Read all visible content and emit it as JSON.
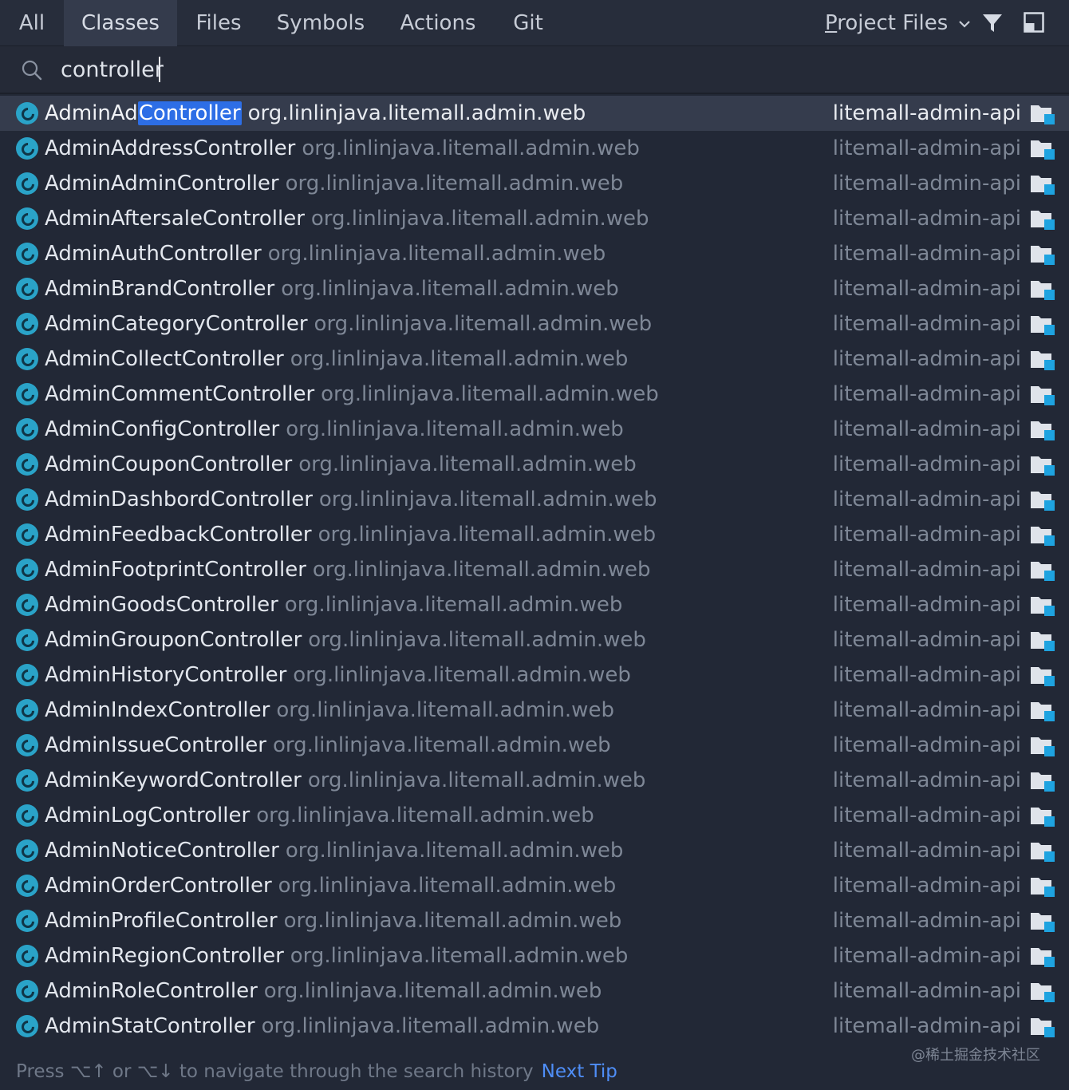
{
  "tabs": [
    {
      "label": "All",
      "active": false
    },
    {
      "label": "Classes",
      "active": true
    },
    {
      "label": "Files",
      "active": false
    },
    {
      "label": "Symbols",
      "active": false
    },
    {
      "label": "Actions",
      "active": false
    },
    {
      "label": "Git",
      "active": false
    }
  ],
  "scope": {
    "label_underlined": "P",
    "label_rest": "roject Files",
    "dropdown_icon": "chevron-down-icon"
  },
  "toolbar_icons": [
    "filter-icon",
    "layout-icon"
  ],
  "search": {
    "icon": "search-icon",
    "value": "controller"
  },
  "colors": {
    "highlight": "#2d6ee6",
    "class_icon": "#2aa3c8",
    "module_icon_accent": "#1ea3e0",
    "next_tip": "#4f8ef7"
  },
  "results": [
    {
      "prefix": "AdminAd",
      "match": "Controller",
      "suffix": "",
      "package": "org.linlinjava.litemall.admin.web",
      "module": "litemall-admin-api",
      "selected": true
    },
    {
      "prefix": "AdminAddressController",
      "match": "",
      "suffix": "",
      "package": "org.linlinjava.litemall.admin.web",
      "module": "litemall-admin-api",
      "selected": false
    },
    {
      "prefix": "AdminAdminController",
      "match": "",
      "suffix": "",
      "package": "org.linlinjava.litemall.admin.web",
      "module": "litemall-admin-api",
      "selected": false
    },
    {
      "prefix": "AdminAftersaleController",
      "match": "",
      "suffix": "",
      "package": "org.linlinjava.litemall.admin.web",
      "module": "litemall-admin-api",
      "selected": false
    },
    {
      "prefix": "AdminAuthController",
      "match": "",
      "suffix": "",
      "package": "org.linlinjava.litemall.admin.web",
      "module": "litemall-admin-api",
      "selected": false
    },
    {
      "prefix": "AdminBrandController",
      "match": "",
      "suffix": "",
      "package": "org.linlinjava.litemall.admin.web",
      "module": "litemall-admin-api",
      "selected": false
    },
    {
      "prefix": "AdminCategoryController",
      "match": "",
      "suffix": "",
      "package": "org.linlinjava.litemall.admin.web",
      "module": "litemall-admin-api",
      "selected": false
    },
    {
      "prefix": "AdminCollectController",
      "match": "",
      "suffix": "",
      "package": "org.linlinjava.litemall.admin.web",
      "module": "litemall-admin-api",
      "selected": false
    },
    {
      "prefix": "AdminCommentController",
      "match": "",
      "suffix": "",
      "package": "org.linlinjava.litemall.admin.web",
      "module": "litemall-admin-api",
      "selected": false
    },
    {
      "prefix": "AdminConfigController",
      "match": "",
      "suffix": "",
      "package": "org.linlinjava.litemall.admin.web",
      "module": "litemall-admin-api",
      "selected": false
    },
    {
      "prefix": "AdminCouponController",
      "match": "",
      "suffix": "",
      "package": "org.linlinjava.litemall.admin.web",
      "module": "litemall-admin-api",
      "selected": false
    },
    {
      "prefix": "AdminDashbordController",
      "match": "",
      "suffix": "",
      "package": "org.linlinjava.litemall.admin.web",
      "module": "litemall-admin-api",
      "selected": false
    },
    {
      "prefix": "AdminFeedbackController",
      "match": "",
      "suffix": "",
      "package": "org.linlinjava.litemall.admin.web",
      "module": "litemall-admin-api",
      "selected": false
    },
    {
      "prefix": "AdminFootprintController",
      "match": "",
      "suffix": "",
      "package": "org.linlinjava.litemall.admin.web",
      "module": "litemall-admin-api",
      "selected": false
    },
    {
      "prefix": "AdminGoodsController",
      "match": "",
      "suffix": "",
      "package": "org.linlinjava.litemall.admin.web",
      "module": "litemall-admin-api",
      "selected": false
    },
    {
      "prefix": "AdminGrouponController",
      "match": "",
      "suffix": "",
      "package": "org.linlinjava.litemall.admin.web",
      "module": "litemall-admin-api",
      "selected": false
    },
    {
      "prefix": "AdminHistoryController",
      "match": "",
      "suffix": "",
      "package": "org.linlinjava.litemall.admin.web",
      "module": "litemall-admin-api",
      "selected": false
    },
    {
      "prefix": "AdminIndexController",
      "match": "",
      "suffix": "",
      "package": "org.linlinjava.litemall.admin.web",
      "module": "litemall-admin-api",
      "selected": false
    },
    {
      "prefix": "AdminIssueController",
      "match": "",
      "suffix": "",
      "package": "org.linlinjava.litemall.admin.web",
      "module": "litemall-admin-api",
      "selected": false
    },
    {
      "prefix": "AdminKeywordController",
      "match": "",
      "suffix": "",
      "package": "org.linlinjava.litemall.admin.web",
      "module": "litemall-admin-api",
      "selected": false
    },
    {
      "prefix": "AdminLogController",
      "match": "",
      "suffix": "",
      "package": "org.linlinjava.litemall.admin.web",
      "module": "litemall-admin-api",
      "selected": false
    },
    {
      "prefix": "AdminNoticeController",
      "match": "",
      "suffix": "",
      "package": "org.linlinjava.litemall.admin.web",
      "module": "litemall-admin-api",
      "selected": false
    },
    {
      "prefix": "AdminOrderController",
      "match": "",
      "suffix": "",
      "package": "org.linlinjava.litemall.admin.web",
      "module": "litemall-admin-api",
      "selected": false
    },
    {
      "prefix": "AdminProfileController",
      "match": "",
      "suffix": "",
      "package": "org.linlinjava.litemall.admin.web",
      "module": "litemall-admin-api",
      "selected": false
    },
    {
      "prefix": "AdminRegionController",
      "match": "",
      "suffix": "",
      "package": "org.linlinjava.litemall.admin.web",
      "module": "litemall-admin-api",
      "selected": false
    },
    {
      "prefix": "AdminRoleController",
      "match": "",
      "suffix": "",
      "package": "org.linlinjava.litemall.admin.web",
      "module": "litemall-admin-api",
      "selected": false
    },
    {
      "prefix": "AdminStatController",
      "match": "",
      "suffix": "",
      "package": "org.linlinjava.litemall.admin.web",
      "module": "litemall-admin-api",
      "selected": false
    }
  ],
  "footer": {
    "hint": "Press ⌥↑ or ⌥↓ to navigate through the search history",
    "next_tip": "Next Tip",
    "watermark": "@稀土掘金技术社区"
  }
}
